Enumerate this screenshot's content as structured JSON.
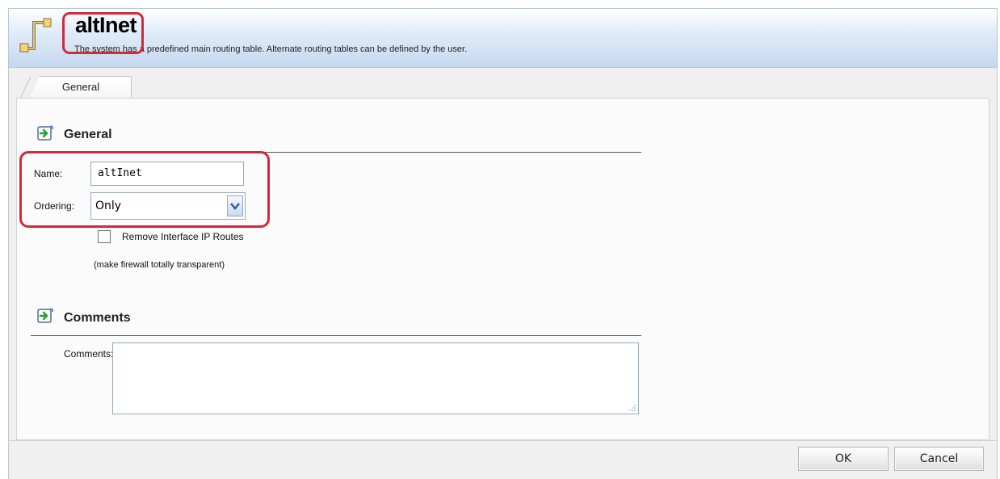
{
  "header": {
    "title": "altInet",
    "description": "The system has a predefined main routing table. Alternate routing tables can be defined by the user."
  },
  "tabs": [
    {
      "label": "General"
    }
  ],
  "sections": {
    "general": {
      "title": "General"
    },
    "comments": {
      "title": "Comments"
    }
  },
  "form": {
    "name_label": "Name:",
    "name_value": "altInet",
    "ordering_label": "Ordering:",
    "ordering_value": "Only",
    "remove_routes_label": "Remove Interface IP Routes",
    "remove_routes_hint": "(make firewall totally transparent)",
    "remove_routes_checked": false,
    "comments_label": "Comments:",
    "comments_value": ""
  },
  "buttons": {
    "ok": "OK",
    "cancel": "Cancel"
  },
  "icons": {
    "header": "routing-table-icon",
    "section": "section-arrow-icon",
    "select": "chevron-down-icon"
  },
  "colors": {
    "highlight": "#d12a3a",
    "header_gradient_end": "#c5d8ef"
  }
}
